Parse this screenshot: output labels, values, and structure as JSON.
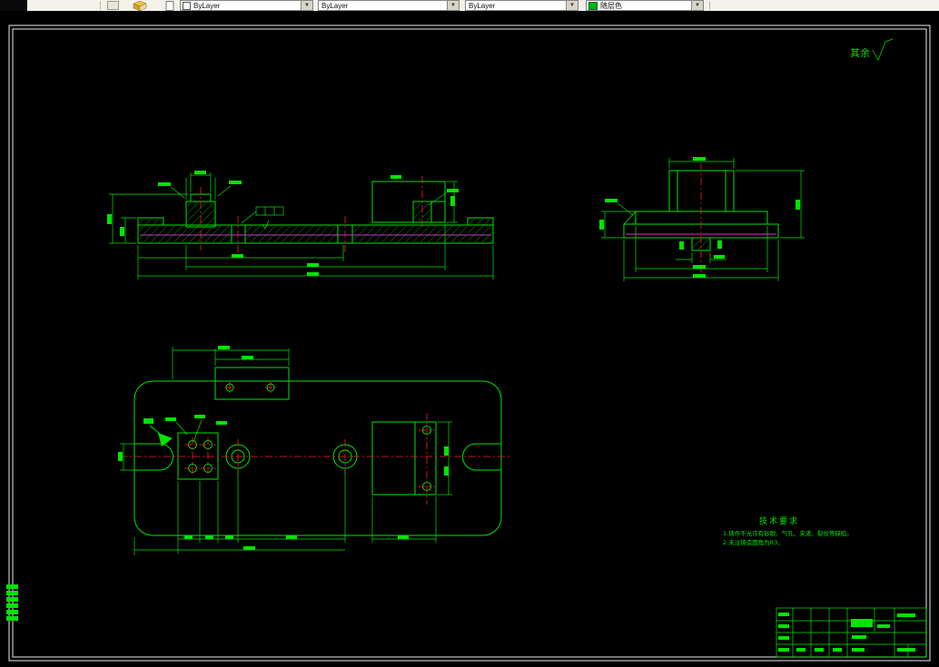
{
  "toolbar": {
    "combos": [
      {
        "label": "ByLayer"
      },
      {
        "label": "ByLayer"
      },
      {
        "label": "ByLayer"
      },
      {
        "label": "随层色"
      }
    ]
  },
  "drawing": {
    "surface_note": "其余",
    "tech_requirements": {
      "title": "技术要求",
      "items": [
        "1.铸件不允许有砂眼、气孔、夹渣、裂纹等缺陷。",
        "2.未注铸造圆角为R3。"
      ]
    }
  },
  "colors": {
    "green": "#00e400",
    "red": "#ff1e1e",
    "magenta": "#cc33cc",
    "white": "#ededed",
    "toolbarBg": "#f3f1e9",
    "swatch": "#00b200"
  }
}
